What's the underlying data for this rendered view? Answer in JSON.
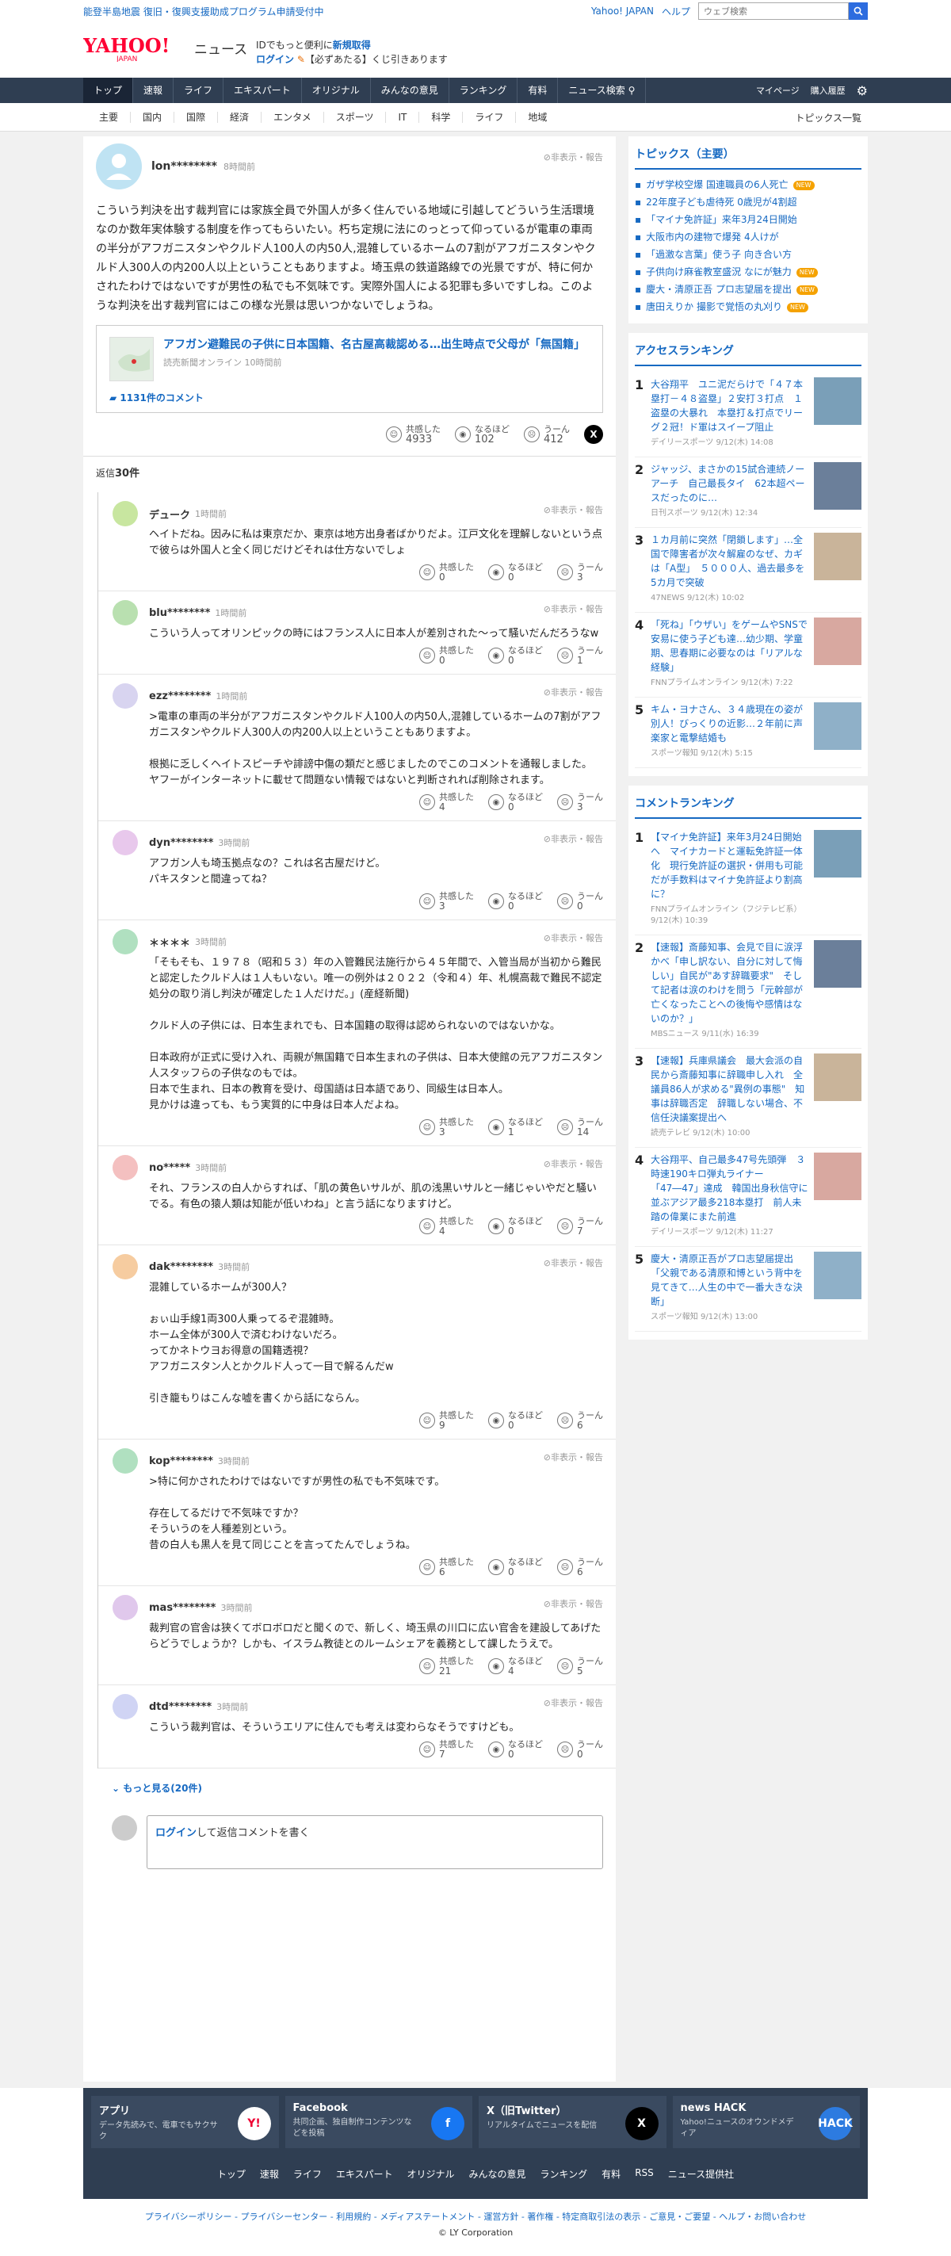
{
  "topbar": {
    "notice": "能登半島地震 復旧・復興支援助成プログラム申請受付中",
    "yahoo": "Yahoo! JAPAN",
    "help": "ヘルプ",
    "search_placeholder": "ウェブ検索"
  },
  "header": {
    "logo": "YAHOO!",
    "logo_sub": "JAPAN",
    "service": "ニュース",
    "line1_a": "IDでもっと便利に",
    "line1_b": "新規取得",
    "line2_a": "ログイン",
    "line2_b": "【必ずあたる】くじ引きあります"
  },
  "nav1": {
    "items": [
      "トップ",
      "速報",
      "ライフ",
      "エキスパート",
      "オリジナル",
      "みんなの意見",
      "ランキング",
      "有料",
      "ニュース検索"
    ],
    "mypage": "マイページ",
    "history": "購入履歴"
  },
  "nav2": {
    "items": [
      "主要",
      "国内",
      "国際",
      "経済",
      "エンタメ",
      "スポーツ",
      "IT",
      "科学",
      "ライフ",
      "地域"
    ],
    "topics_list": "トピックス一覧"
  },
  "original": {
    "user": "lon********",
    "time": "8時間前",
    "hide": "非表示・報告",
    "text": "こういう判決を出す裁判官には家族全員で外国人が多く住んでいる地域に引越してどういう生活環境なのか数年実体験する制度を作ってもらいたい。朽ち定規に法にのっとって仰っているが電車の車両の半分がアフガニスタンやクルド人100人の内50人,混雑しているホームの7割がアフガニスタンやクルド人300人の内200人以上ということもありますよ。埼玉県の鉄道路線での光景ですが、特に何かされたわけではないですが男性の私でも不気味です。実際外国人による犯罪も多いですしね。このような判決を出す裁判官にはこの様な光景は思いつかないでしょうね。",
    "article_title": "アフガン避難民の子供に日本国籍、名古屋高裁認める…出生時点で父母が「無国籍」",
    "article_src": "読売新聞オンライン 10時間前",
    "article_comments": "1131件のコメント",
    "r1": "共感した",
    "r1n": "4933",
    "r2": "なるほど",
    "r2n": "102",
    "r3": "うーん",
    "r3n": "412"
  },
  "reply_count_prefix": "返信",
  "reply_count": "30件",
  "labels": {
    "r1": "共感した",
    "r2": "なるほど",
    "r3": "うーん",
    "hide": "非表示・報告"
  },
  "replies": [
    {
      "user": "デューク",
      "time": "1時間前",
      "text": "ヘイトだね。因みに私は東京だか、東京は地方出身者ばかりだよ。江戸文化を理解しないという点で彼らは外国人と全く同じだけどそれは仕方ないでしょ",
      "n": [
        "0",
        "0",
        "3"
      ]
    },
    {
      "user": "blu********",
      "time": "1時間前",
      "text": "こういう人ってオリンピックの時にはフランス人に日本人が差別された〜って騒いだんだろうなw",
      "n": [
        "0",
        "0",
        "1"
      ]
    },
    {
      "user": "ezz********",
      "time": "1時間前",
      "text": ">電車の車両の半分がアフガニスタンやクルド人100人の内50人,混雑しているホームの7割がアフガニスタンやクルド人300人の内200人以上ということもありますよ。\n\n根拠に乏しくヘイトスピーチや誹謗中傷の類だと感じましたのでこのコメントを通報しました。\nヤフーがインターネットに載せて問題ない情報ではないと判断されれば削除されます。",
      "n": [
        "4",
        "0",
        "3"
      ]
    },
    {
      "user": "dyn********",
      "time": "3時間前",
      "text": "アフガン人も埼玉拠点なの？これは名古屋だけど。\nパキスタンと間違ってね？",
      "n": [
        "3",
        "0",
        "0"
      ]
    },
    {
      "user": "＊＊＊＊",
      "time": "3時間前",
      "text": "「そもそも、１９７８（昭和５３）年の入管難民法施行から４５年間で、入管当局が当初から難民と認定したクルド人は１人もいない。唯一の例外は２０２２（令和４）年、札幌高裁で難民不認定処分の取り消し判決が確定した１人だけだ。」(産経新聞)\n\nクルド人の子供には、日本生まれでも、日本国籍の取得は認められないのではないかな。\n\n日本政府が正式に受け入れ、両親が無国籍で日本生まれの子供は、日本大使館の元アフガニスタン人スタッフらの子供なのもでは。\n日本で生まれ、日本の教育を受け、母国語は日本語であり、同級生は日本人。\n見かけは違っても、もう実質的に中身は日本人だよね。",
      "n": [
        "3",
        "1",
        "14"
      ]
    },
    {
      "user": "no*****",
      "time": "3時間前",
      "text": "それ、フランスの白人からすれば、「肌の黄色いサルが、肌の浅黒いサルと一緒じゃいやだと騒いでる。有色の猿人類は知能が低いわね」と言う話になりますけど。",
      "n": [
        "4",
        "0",
        "7"
      ]
    },
    {
      "user": "dak********",
      "time": "3時間前",
      "text": "混雑しているホームが300人？\n\nぉぃ山手線1両300人乗ってるぞ混雑時。\nホーム全体が300人で済むわけないだろ。\nってかネトウヨお得意の国籍透視？\nアフガニスタン人とかクルド人って一目で解るんだw\n\n引き籠もりはこんな嘘を書くから話にならん。",
      "n": [
        "9",
        "0",
        "6"
      ]
    },
    {
      "user": "kop********",
      "time": "3時間前",
      "text": ">特に何かされたわけではないですが男性の私でも不気味です。\n\n存在してるだけで不気味ですか？\nそういうのを人種差別という。\n昔の白人も黒人を見て同じことを言ってたんでしょうね。",
      "n": [
        "6",
        "0",
        "6"
      ]
    },
    {
      "user": "mas********",
      "time": "3時間前",
      "text": "裁判官の官舎は狭くてボロボロだと聞くので、新しく、埼玉県の川口に広い官舎を建設してあげたらどうでしょうか？しかも、イスラム教徒とのルームシェアを義務として課したうえで。",
      "n": [
        "21",
        "4",
        "5"
      ]
    },
    {
      "user": "dtd********",
      "time": "3時間前",
      "text": "こういう裁判官は、そういうエリアに住んでも考えは変わらなそうですけども。",
      "n": [
        "7",
        "0",
        "0"
      ]
    }
  ],
  "more": "もっと見る",
  "more_count": "(20件)",
  "comment_box": {
    "login": "ログイン",
    "rest": "して返信コメントを書く"
  },
  "topics": {
    "title": "トピックス（主要）",
    "new_label": "NEW",
    "items": [
      {
        "t": "ガザ学校空爆 国連職員の6人死亡",
        "new": true
      },
      {
        "t": "22年度子ども虐待死 0歳児が4割超",
        "new": false
      },
      {
        "t": "「マイナ免許証」来年3月24日開始",
        "new": false
      },
      {
        "t": "大阪市内の建物で爆発 4人けが",
        "new": false
      },
      {
        "t": "「過激な言葉」使う子 向き合い方",
        "new": false
      },
      {
        "t": "子供向け麻雀教室盛況 なにが魅力",
        "new": true
      },
      {
        "t": "慶大・清原正吾 プロ志望届を提出",
        "new": true
      },
      {
        "t": "唐田えりか 撮影で覚悟の丸刈り",
        "new": true
      }
    ]
  },
  "access": {
    "title": "アクセスランキング",
    "items": [
      {
        "t": "大谷翔平　ユニ泥だらけで「４７本塁打－４８盗塁」２安打３打点　１盗塁の大暴れ　本塁打＆打点でリーグ２冠！ド軍はスイープ阻止",
        "s": "デイリースポーツ 9/12(木) 14:08"
      },
      {
        "t": "ジャッジ、まさかの15試合連続ノーアーチ　自己最長タイ　62本超ペースだったのに…",
        "s": "日刊スポーツ 9/12(木) 12:34"
      },
      {
        "t": "１カ月前に突然「閉鎖します」…全国で障害者が次々解雇のなぜ、カギは「A型」　５０００人、過去最多を5カ月で突破",
        "s": "47NEWS 9/12(木) 10:02"
      },
      {
        "t": "「死ね」「ウザい」をゲームやSNSで安易に使う子ども達…幼少期、学童期、思春期に必要なのは「リアルな経験」",
        "s": "FNNプライムオンライン 9/12(木) 7:22"
      },
      {
        "t": "キム・ヨナさん、３４歳現在の姿が別人！びっくりの近影…２年前に声楽家と電撃結婚も",
        "s": "スポーツ報知 9/12(木) 5:15"
      }
    ]
  },
  "commentrank": {
    "title": "コメントランキング",
    "items": [
      {
        "t": "【マイナ免許証】来年3月24日開始へ　マイナカードと運転免許証一体化　現行免許証の選択・併用も可能だが手数料はマイナ免許証より割高に？",
        "s": "FNNプライムオンライン（フジテレビ系）9/12(木) 10:39"
      },
      {
        "t": "【速報】斎藤知事、会見で目に涙浮かべ「申し訳ない、自分に対して悔しい」自民が\"あす辞職要求\"　そして記者は涙のわけを問う「元幹部が亡くなったことへの後悔や感情はないのか？」",
        "s": "MBSニュース 9/11(水) 16:39"
      },
      {
        "t": "【速報】兵庫県議会　最大会派の自民から斎藤知事に辞職申し入れ　全議員86人が求める\"異例の事態\"　知事は辞職否定　辞職しない場合、不信任決議案提出へ",
        "s": "読売テレビ 9/12(木) 10:00"
      },
      {
        "t": "大谷翔平、自己最多47号先頭弾　３時速190キロ弾丸ライナー　「47―47」達成　韓国出身秋信守に並ぶアジア最多218本塁打　前人未踏の偉業にまた前進",
        "s": "デイリースポーツ 9/12(木) 11:27"
      },
      {
        "t": "慶大・清原正吾がプロ志望届提出　「父親である清原和博という背中を見てきて…人生の中で一番大きな決断」",
        "s": "スポーツ報知 9/12(木) 13:00"
      }
    ]
  },
  "footer": {
    "apps": [
      {
        "t": "アプリ",
        "d": "データ先読みで、電車でもサクサク",
        "i": "Y!"
      },
      {
        "t": "Facebook",
        "d": "共同企画、独自制作コンテンツなどを投稿",
        "i": "f"
      },
      {
        "t": "X（旧Twitter）",
        "d": "リアルタイムでニュースを配信",
        "i": "X"
      },
      {
        "t": "news HACK",
        "d": "Yahoo!ニュースのオウンドメディア",
        "i": "HACK"
      }
    ],
    "nav": [
      "トップ",
      "速報",
      "ライフ",
      "エキスパート",
      "オリジナル",
      "みんなの意見",
      "ランキング",
      "有料",
      "RSS",
      "ニュース提供社"
    ],
    "links": "プライバシーポリシー - プライバシーセンター - 利用規約 - メディアステートメント - 運営方針 - 著作権 - 特定商取引法の表示 - ご意見・ご要望 - ヘルプ・お問い合わせ",
    "copy": "© LY Corporation"
  },
  "colors": {
    "accent": "#1669c2",
    "nav": "#2f3e52",
    "logo": "#ff0033"
  }
}
